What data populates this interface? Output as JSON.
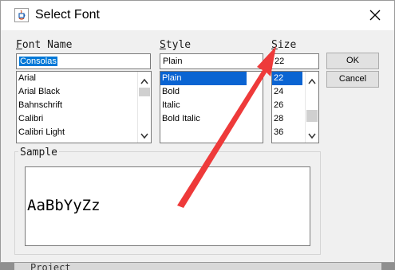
{
  "window": {
    "title": "Select Font"
  },
  "labels": {
    "font_name": {
      "accel": "F",
      "rest": "ont Name"
    },
    "style": {
      "accel": "S",
      "rest": "tyle"
    },
    "size": {
      "accel": "S",
      "rest": "ize"
    }
  },
  "font_name": {
    "value": "Consolas",
    "items": [
      "Arial",
      "Arial Black",
      "Bahnschrift",
      "Calibri",
      "Calibri Light"
    ]
  },
  "style": {
    "value": "Plain",
    "items": [
      "Plain",
      "Bold",
      "Italic",
      "Bold Italic"
    ],
    "selected": "Plain"
  },
  "size": {
    "value": "22",
    "items": [
      "22",
      "24",
      "26",
      "28",
      "36"
    ],
    "selected": "22"
  },
  "buttons": {
    "ok": "OK",
    "cancel": "Cancel"
  },
  "sample": {
    "title": "Sample",
    "text": "AaBbYyZz"
  },
  "background_text": "Project",
  "colors": {
    "selection": "#0a64d2",
    "annotation_arrow": "#ee3a3a"
  }
}
